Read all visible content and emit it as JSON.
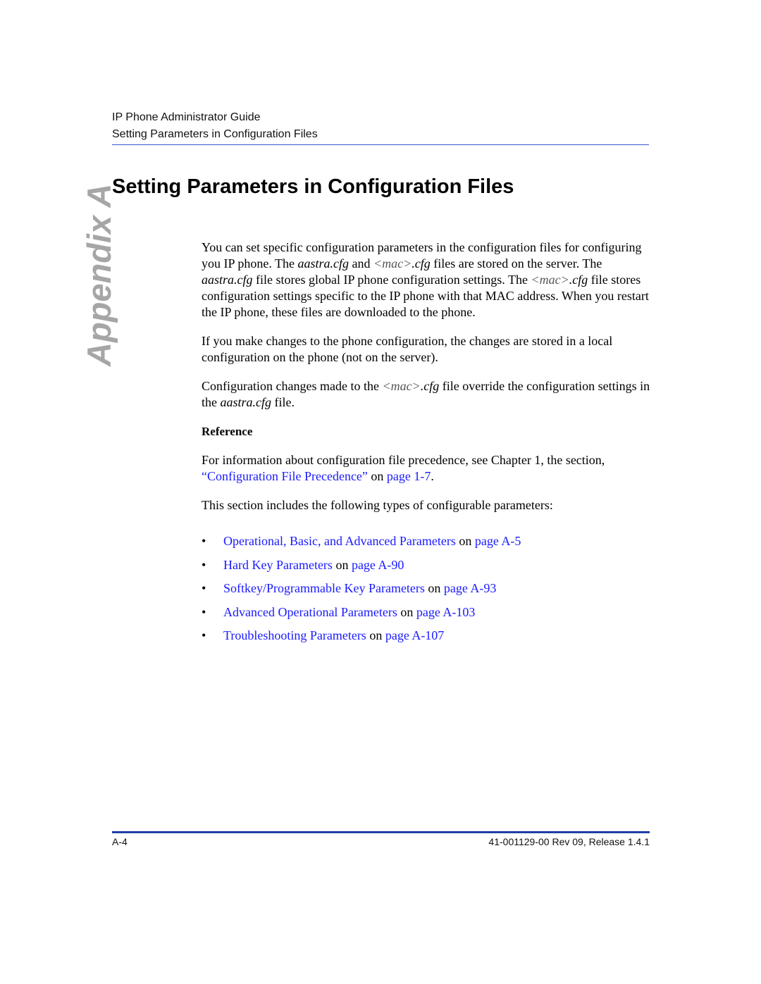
{
  "header": {
    "guide_title": "IP Phone Administrator Guide",
    "section_title": "Setting Parameters in Configuration Files"
  },
  "side_tab": "Appendix A",
  "page_title": "Setting Parameters in Configuration Files",
  "intro": {
    "p1": {
      "t1": "You can set specific configuration parameters in the configuration files for configuring you IP phone. The ",
      "i1": "aastra.cfg",
      "t2": " and ",
      "i2a": "<mac>",
      "i2b": ".cfg",
      "t3": " files are stored on the server. The ",
      "i3": "aastra.cfg",
      "t4": " file stores global IP phone configuration settings. The ",
      "i4a": "<mac>",
      "i4b": ".cfg",
      "t5": " file stores configuration settings specific to the IP phone with that MAC address. When you restart the IP phone, these files are downloaded to the phone."
    },
    "p2": "If you make changes to the phone configuration, the changes are stored in a local configuration on the phone (not on the server).",
    "p3": {
      "t1": "Configuration changes made to the ",
      "i1a": "<mac>",
      "i1b": ".cfg",
      "t2": " file override the configuration settings in the ",
      "i2": "aastra.cfg",
      "t3": " file."
    }
  },
  "reference": {
    "heading": "Reference",
    "text": "For information about configuration file precedence, see Chapter 1, the section, ",
    "link_label": "“Configuration File Precedence”",
    "on": " on ",
    "page_link": "page 1-7",
    "end": "."
  },
  "list_intro": "This section includes the following types of configurable parameters:",
  "bullet_char": "•",
  "bullets": [
    {
      "label": "Operational, Basic, and Advanced Parameters",
      "on": " on ",
      "page": "page A-5"
    },
    {
      "label": "Hard Key Parameters",
      "on": " on ",
      "page": "page A-90"
    },
    {
      "label": "Softkey/Programmable Key Parameters",
      "on": " on ",
      "page": "page A-93"
    },
    {
      "label": "Advanced Operational Parameters",
      "on": " on ",
      "page": "page A-103"
    },
    {
      "label": "Troubleshooting Parameters",
      "on": " on ",
      "page": "page A-107"
    }
  ],
  "footer": {
    "page_number": "A-4",
    "doc_id": "41-001129-00 Rev 09, Release 1.4.1"
  },
  "colors": {
    "link": "#1a1aff",
    "rule": "#1f3fa8",
    "side_tab": "#a6a6a6"
  }
}
